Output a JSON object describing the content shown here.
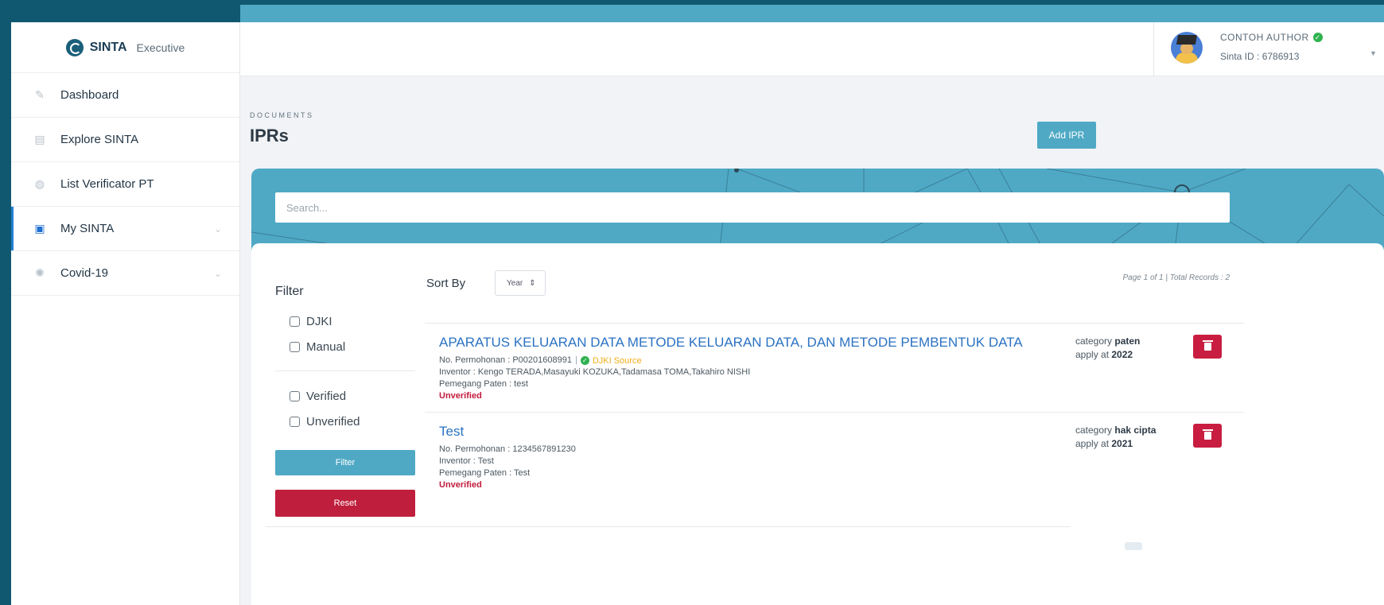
{
  "brand": {
    "name": "SINTA",
    "sub": "Executive"
  },
  "sidebar": {
    "items": [
      {
        "label": "Dashboard",
        "icon": "pencil-icon"
      },
      {
        "label": "Explore SINTA",
        "icon": "document-icon"
      },
      {
        "label": "List Verificator PT",
        "icon": "user-circle-icon"
      },
      {
        "label": "My SINTA",
        "icon": "id-card-icon",
        "active": true
      },
      {
        "label": "Covid-19",
        "icon": "virus-icon"
      }
    ]
  },
  "header": {
    "user_name": "CONTOH AUTHOR",
    "user_id": "Sinta ID : 6786913"
  },
  "page": {
    "kicker": "DOCUMENTS",
    "title": "IPRs",
    "add_label": "Add IPR"
  },
  "search": {
    "placeholder": "Search..."
  },
  "filter": {
    "title": "Filter",
    "options": [
      "DJKI",
      "Manual",
      "Verified",
      "Unverified"
    ],
    "filter_label": "Filter",
    "reset_label": "Reset"
  },
  "sort": {
    "label": "Sort By",
    "selected": "Year"
  },
  "page_info": "Page 1 of 1 | Total Records : 2",
  "records": [
    {
      "title": "APARATUS KELUARAN DATA METODE KELUARAN DATA, DAN METODE PEMBENTUK DATA",
      "no_permohonan": "No. Permohonan : P00201608991",
      "source": "DJKI Source",
      "inventor": "Inventor : Kengo TERADA,Masayuki KOZUKA,Tadamasa TOMA,Takahiro NISHI",
      "pemegang": "Pemegang Paten : test",
      "status": "Unverified",
      "category_label": "category",
      "category": "paten",
      "apply_label": "apply at",
      "apply_year": "2022"
    },
    {
      "title": "Test",
      "no_permohonan": "No. Permohonan : 1234567891230",
      "inventor": "Inventor : Test",
      "pemegang": "Pemegang Paten : Test",
      "status": "Unverified",
      "category_label": "category",
      "category": "hak cipta",
      "apply_label": "apply at",
      "apply_year": "2021"
    }
  ],
  "colors": {
    "accent": "#4fa9c5",
    "danger": "#c81d40",
    "link": "#2b72c2",
    "source": "#f0ad18",
    "outer": "#10586f"
  }
}
